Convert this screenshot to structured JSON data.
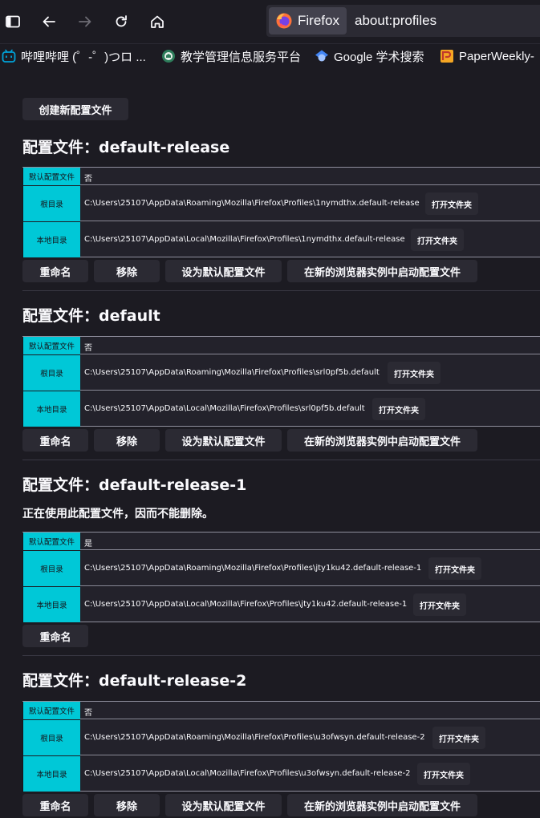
{
  "browser": {
    "identity_label": "Firefox",
    "url": "about:profiles",
    "bookmarks": [
      {
        "label": "哔哩哔哩 (゜-゜)つロ ...",
        "icon": "bilibili-icon"
      },
      {
        "label": "教学管理信息服务平台",
        "icon": "university-icon"
      },
      {
        "label": "Google 学术搜索",
        "icon": "google-scholar-icon"
      },
      {
        "label": "PaperWeekly-",
        "icon": "paperweekly-icon"
      }
    ]
  },
  "page": {
    "create_button": "创建新配置文件",
    "labels": {
      "default": "默认配置文件",
      "root": "根目录",
      "local": "本地目录",
      "open_folder": "打开文件夹"
    },
    "actions": {
      "rename": "重命名",
      "remove": "移除",
      "set_default": "设为默认配置文件",
      "launch": "在新的浏览器实例中启动配置文件"
    },
    "profiles": [
      {
        "heading": "配置文件：default-release",
        "is_default": "否",
        "root": "C:\\Users\\25107\\AppData\\Roaming\\Mozilla\\Firefox\\Profiles\\1nymdthx.default-release",
        "local": "C:\\Users\\25107\\AppData\\Local\\Mozilla\\Firefox\\Profiles\\1nymdthx.default-release"
      },
      {
        "heading": "配置文件：default",
        "is_default": "否",
        "root": "C:\\Users\\25107\\AppData\\Roaming\\Mozilla\\Firefox\\Profiles\\srl0pf5b.default",
        "local": "C:\\Users\\25107\\AppData\\Local\\Mozilla\\Firefox\\Profiles\\srl0pf5b.default"
      },
      {
        "heading": "配置文件：default-release-1",
        "note": "正在使用此配置文件，因而不能删除。",
        "is_default": "是",
        "root": "C:\\Users\\25107\\AppData\\Roaming\\Mozilla\\Firefox\\Profiles\\jty1ku42.default-release-1",
        "local": "C:\\Users\\25107\\AppData\\Local\\Mozilla\\Firefox\\Profiles\\jty1ku42.default-release-1"
      },
      {
        "heading": "配置文件：default-release-2",
        "is_default": "否",
        "root": "C:\\Users\\25107\\AppData\\Roaming\\Mozilla\\Firefox\\Profiles\\u3ofwsyn.default-release-2",
        "local": "C:\\Users\\25107\\AppData\\Local\\Mozilla\\Firefox\\Profiles\\u3ofwsyn.default-release-2"
      }
    ]
  },
  "colors": {
    "background": "#1c1b22",
    "header_cell": "#00c8d7",
    "button": "#2b2a33",
    "text": "#fbfbfe"
  }
}
